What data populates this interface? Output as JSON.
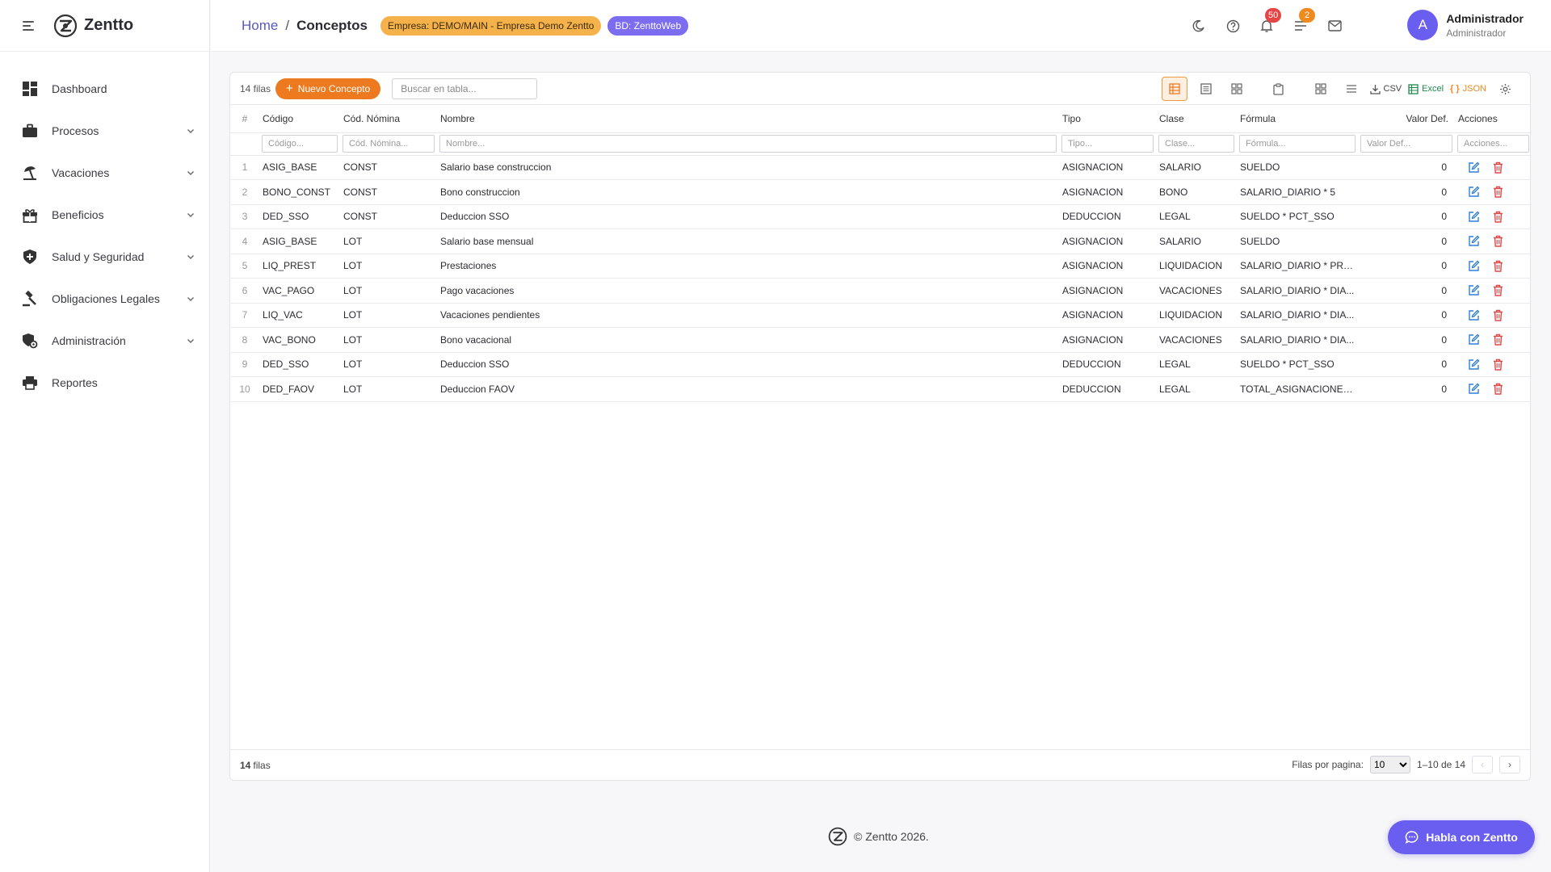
{
  "app": {
    "brand": "Zentto"
  },
  "sidebar": {
    "items": [
      {
        "label": "Dashboard",
        "icon": "dashboard-icon",
        "expandable": false
      },
      {
        "label": "Procesos",
        "icon": "briefcase-icon",
        "expandable": true
      },
      {
        "label": "Vacaciones",
        "icon": "beach-icon",
        "expandable": true
      },
      {
        "label": "Beneficios",
        "icon": "gift-icon",
        "expandable": true
      },
      {
        "label": "Salud y Seguridad",
        "icon": "shield-icon",
        "expandable": true
      },
      {
        "label": "Obligaciones Legales",
        "icon": "gavel-icon",
        "expandable": true
      },
      {
        "label": "Administración",
        "icon": "admin-icon",
        "expandable": true
      },
      {
        "label": "Reportes",
        "icon": "printer-icon",
        "expandable": false
      }
    ]
  },
  "header": {
    "breadcrumb_home": "Home",
    "breadcrumb_sep": "/",
    "breadcrumb_current": "Conceptos",
    "chip_empresa": "Empresa: DEMO/MAIN - Empresa Demo Zentto",
    "chip_bd": "BD: ZenttoWeb",
    "notifications_count": "50",
    "tasks_count": "2",
    "user_initial": "A",
    "user_name": "Administrador",
    "user_role": "Administrador"
  },
  "toolbar": {
    "row_count": "14 filas",
    "new_button": "Nuevo Concepto",
    "search_placeholder": "Buscar en tabla...",
    "csv_label": "CSV",
    "excel_label": "Excel",
    "json_label": "JSON"
  },
  "table": {
    "columns": [
      "#",
      "Código",
      "Cód. Nómina",
      "Nombre",
      "Tipo",
      "Clase",
      "Fórmula",
      "Valor Def.",
      "Acciones"
    ],
    "filters": [
      "Código...",
      "Cód. Nómina...",
      "Nombre...",
      "Tipo...",
      "Clase...",
      "Fórmula...",
      "Valor Def...",
      "Acciones..."
    ],
    "rows": [
      [
        "1",
        "ASIG_BASE",
        "CONST",
        "Salario base construccion",
        "ASIGNACION",
        "SALARIO",
        "SUELDO",
        "0"
      ],
      [
        "2",
        "BONO_CONST",
        "CONST",
        "Bono construccion",
        "ASIGNACION",
        "BONO",
        "SALARIO_DIARIO * 5",
        "0"
      ],
      [
        "3",
        "DED_SSO",
        "CONST",
        "Deduccion SSO",
        "DEDUCCION",
        "LEGAL",
        "SUELDO * PCT_SSO",
        "0"
      ],
      [
        "4",
        "ASIG_BASE",
        "LOT",
        "Salario base mensual",
        "ASIGNACION",
        "SALARIO",
        "SUELDO",
        "0"
      ],
      [
        "5",
        "LIQ_PREST",
        "LOT",
        "Prestaciones",
        "ASIGNACION",
        "LIQUIDACION",
        "SALARIO_DIARIO * PRE...",
        "0"
      ],
      [
        "6",
        "VAC_PAGO",
        "LOT",
        "Pago vacaciones",
        "ASIGNACION",
        "VACACIONES",
        "SALARIO_DIARIO * DIA...",
        "0"
      ],
      [
        "7",
        "LIQ_VAC",
        "LOT",
        "Vacaciones pendientes",
        "ASIGNACION",
        "LIQUIDACION",
        "SALARIO_DIARIO * DIA...",
        "0"
      ],
      [
        "8",
        "VAC_BONO",
        "LOT",
        "Bono vacacional",
        "ASIGNACION",
        "VACACIONES",
        "SALARIO_DIARIO * DIA...",
        "0"
      ],
      [
        "9",
        "DED_SSO",
        "LOT",
        "Deduccion SSO",
        "DEDUCCION",
        "LEGAL",
        "SUELDO * PCT_SSO",
        "0"
      ],
      [
        "10",
        "DED_FAOV",
        "LOT",
        "Deduccion FAOV",
        "DEDUCCION",
        "LEGAL",
        "TOTAL_ASIGNACIONES ...",
        "0"
      ]
    ]
  },
  "footer": {
    "count_num": "14",
    "count_label": "filas",
    "rows_per_page_label": "Filas por pagina:",
    "rows_per_page": "10",
    "range": "1–10 de 14"
  },
  "copyright": "© Zentto 2026.",
  "chat_button": "Habla con Zentto",
  "colors": {
    "accent": "#ee7a1f",
    "primary": "#6a5ef0",
    "edit": "#2f7fd8",
    "delete": "#e04848"
  }
}
